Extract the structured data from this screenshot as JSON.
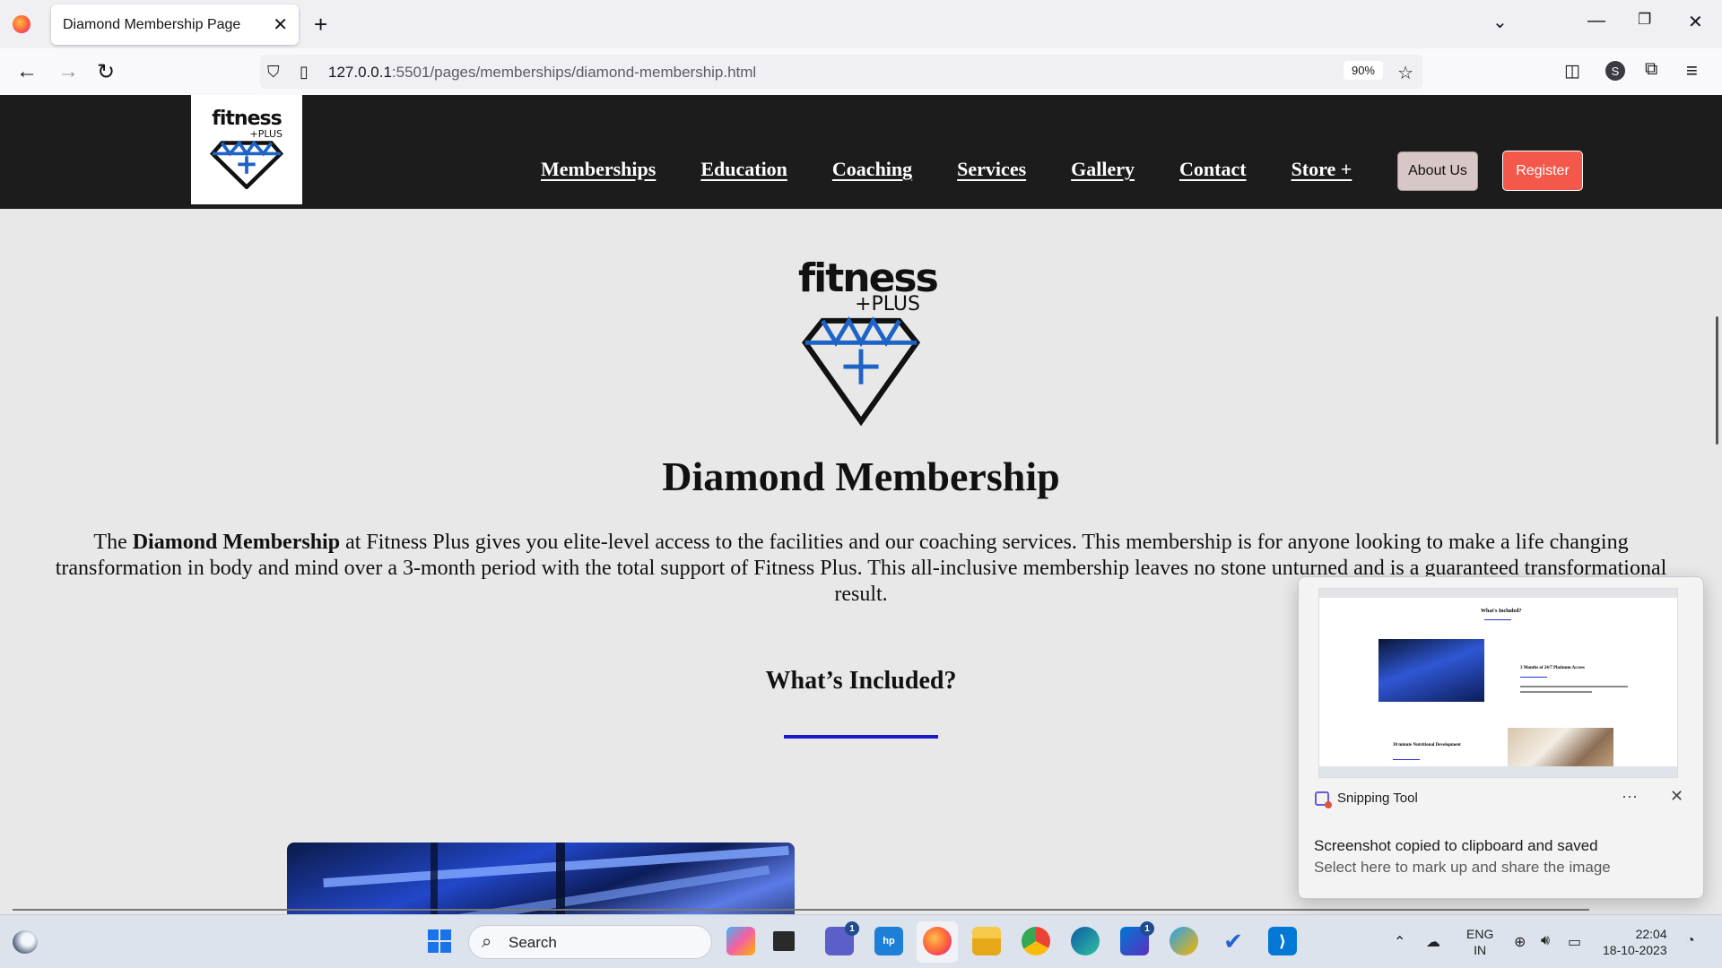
{
  "browser": {
    "tab_title": "Diamond Membership Page",
    "url_host": "127.0.0.1",
    "url_path": ":5501/pages/memberships/diamond-membership.html",
    "zoom": "90%"
  },
  "header": {
    "logo_word": "fitness",
    "logo_plus": "+PLUS",
    "nav": [
      "Memberships",
      "Education",
      "Coaching",
      "Services",
      "Gallery",
      "Contact",
      "Store +"
    ],
    "about_label": "About Us",
    "register_label": "Register"
  },
  "main": {
    "hero_word": "fitness",
    "hero_plus": "+PLUS",
    "title": "Diamond Membership",
    "intro_pre": "The ",
    "intro_bold": "Diamond Membership",
    "intro_post": " at Fitness Plus gives you elite-level access to the facilities and our coaching services. This membership is for anyone looking to make a life changing transformation in body and mind over a 3-month period with the total support of Fitness Plus. This all-inclusive membership leaves no stone unturned and is a guaranteed transformational result.",
    "section_title": "What’s Included?"
  },
  "toast": {
    "app_name": "Snipping Tool",
    "more": "···",
    "line1": "Screenshot copied to clipboard and saved",
    "line2": "Select here to mark up and share the image",
    "thumb_title": "What's Included?",
    "thumb_item1": "3 Months of 24/7 Platinum Access",
    "thumb_item2": "30 minute Nutritional Development"
  },
  "taskbar": {
    "search_label": "Search",
    "lang_line1": "ENG",
    "lang_line2": "IN",
    "time": "22:04",
    "date": "18-10-2023",
    "badges": {
      "teams": "1",
      "store": "1"
    }
  },
  "colors": {
    "header_bg": "#1c1c1c",
    "register_bg": "#f4584b",
    "about_bg": "#d8c7c7",
    "accent_rule": "#1a1acc",
    "diamond_blue": "#1e63c6"
  }
}
